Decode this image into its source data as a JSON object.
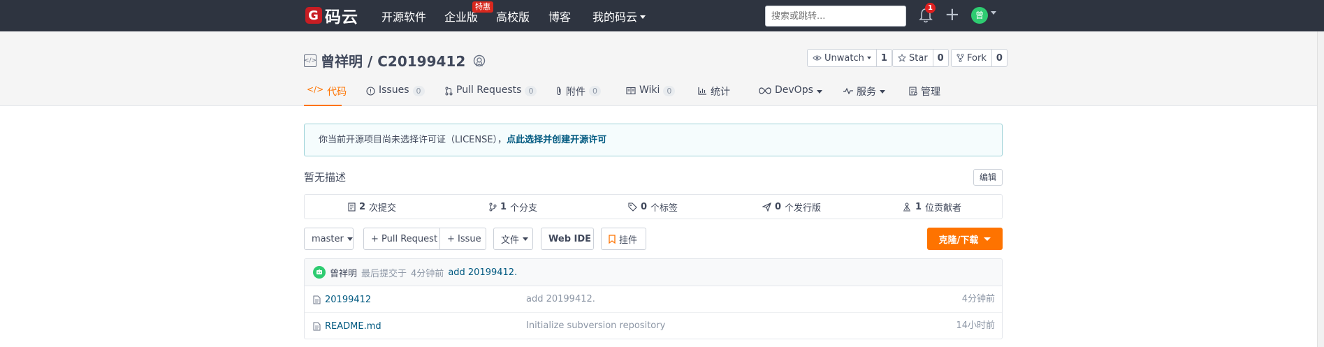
{
  "topbar": {
    "logo_text": "码云",
    "logo_mark": "G",
    "nav": [
      "开源软件",
      "企业版",
      "高校版",
      "博客",
      "我的码云"
    ],
    "hot_badge": "特惠",
    "search_placeholder": "搜索或跳转...",
    "notification_count": "1",
    "avatar_initial": "曾"
  },
  "repo": {
    "title": "曾祥明 / C20199412",
    "watch": {
      "label": "Unwatch",
      "count": "1"
    },
    "star": {
      "label": "Star",
      "count": "0"
    },
    "fork": {
      "label": "Fork",
      "count": "0"
    }
  },
  "tabs": [
    {
      "label": "代码",
      "icon": "code-icon"
    },
    {
      "label": "Issues",
      "count": "0",
      "icon": "issue-icon"
    },
    {
      "label": "Pull Requests",
      "count": "0",
      "icon": "pull-request-icon"
    },
    {
      "label": "附件",
      "count": "0",
      "icon": "attachment-icon"
    },
    {
      "label": "Wiki",
      "count": "0",
      "icon": "wiki-icon"
    },
    {
      "label": "统计",
      "icon": "chart-icon"
    },
    {
      "label": "DevOps",
      "icon": "infinity-icon"
    },
    {
      "label": "服务",
      "icon": "pulse-icon"
    },
    {
      "label": "管理",
      "icon": "settings-icon"
    }
  ],
  "license": {
    "text": "你当前开源项目尚未选择许可证（LICENSE），",
    "link": "点此选择并创建开源许可"
  },
  "description": {
    "text": "暂无描述",
    "edit_label": "编辑"
  },
  "stats": [
    {
      "count": "2",
      "label": "次提交"
    },
    {
      "count": "1",
      "label": "个分支"
    },
    {
      "count": "0",
      "label": "个标签"
    },
    {
      "count": "0",
      "label": "个发行版"
    },
    {
      "count": "1",
      "label": "位贡献者"
    }
  ],
  "toolbar": {
    "branch": "master",
    "pull_request": "+ Pull Request",
    "issue": "+ Issue",
    "file": "文件",
    "web_ide": "Web IDE",
    "bookmark": "挂件",
    "clone": "克隆/下载"
  },
  "latest_commit": {
    "author": "曾祥明",
    "prefix": "最后提交于",
    "time": "4分钟前",
    "message": "add 20199412."
  },
  "files": [
    {
      "name": "20199412",
      "message": "add 20199412.",
      "time": "4分钟前"
    },
    {
      "name": "README.md",
      "message": "Initialize subversion repository",
      "time": "14小时前"
    }
  ],
  "colors": {
    "topbar": "#2e3440",
    "accent": "#fe7300",
    "link": "#005980",
    "avatar": "#2ecc71"
  }
}
